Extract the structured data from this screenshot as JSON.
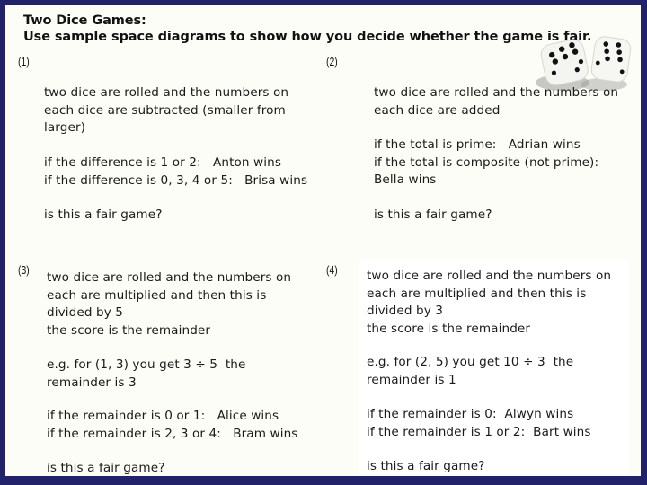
{
  "header": {
    "title_line1": "Two Dice Games:",
    "title_line2": "Use sample space diagrams to show how you decide whether the game is fair."
  },
  "image": {
    "icon": "dice-icon",
    "description": "two white dice"
  },
  "games": [
    {
      "number": "(1)",
      "rules": [
        "two dice are rolled and the numbers on",
        "each dice are subtracted (smaller from",
        "larger)"
      ],
      "conditions": [
        "if the difference is 1 or 2:   Anton wins",
        "if the difference is 0, 3, 4 or 5:   Brisa wins"
      ],
      "question": "is this a fair game?"
    },
    {
      "number": "(2)",
      "rules": [
        "two dice are rolled and the numbers on",
        "each dice are added"
      ],
      "conditions": [
        "if the total is prime:   Adrian wins",
        "if the total is composite (not prime):",
        "Bella wins"
      ],
      "question": "is this a fair game?"
    },
    {
      "number": "(3)",
      "rules": [
        "two dice are rolled and the numbers on",
        "each are multiplied and then this is",
        "divided by 5",
        "the score is the remainder"
      ],
      "example": [
        "e.g. for (1, 3) you get 3 ÷ 5  the",
        "remainder is 3"
      ],
      "conditions": [
        "if the remainder is 0 or 1:   Alice wins",
        "if the remainder is 2, 3 or 4:   Bram wins"
      ],
      "question": "is this a fair game?"
    },
    {
      "number": "(4)",
      "rules": [
        "two dice are rolled and the numbers on",
        "each are multiplied and then this is",
        "divided by 3",
        "the score is the remainder"
      ],
      "example": [
        "e.g. for (2, 5) you get 10 ÷ 3  the",
        "remainder is 1"
      ],
      "conditions": [
        "if the remainder is 0:  Alwyn wins",
        "if the remainder is 1 or 2:  Bart wins"
      ],
      "question": "is this a fair game?"
    }
  ],
  "colors": {
    "border": "#22226a",
    "background": "#fdfdf7"
  }
}
